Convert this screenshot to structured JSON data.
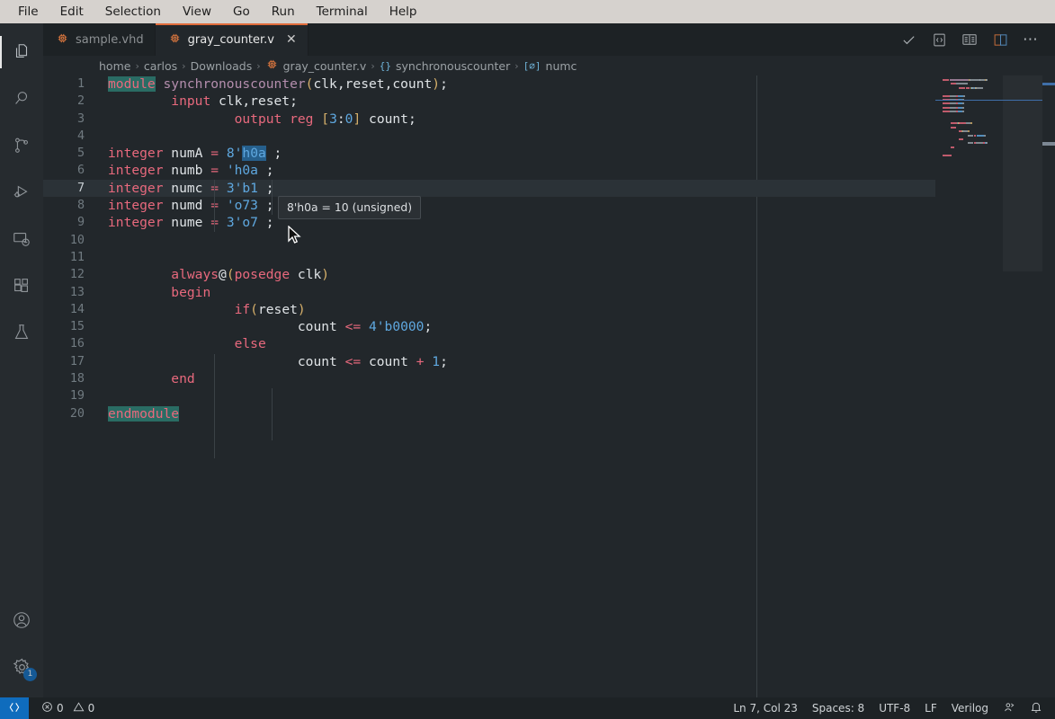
{
  "menubar": {
    "items": [
      "File",
      "Edit",
      "Selection",
      "View",
      "Go",
      "Run",
      "Terminal",
      "Help"
    ]
  },
  "activitybar": {
    "items": [
      {
        "name": "explorer",
        "icon": "files-icon",
        "active": true
      },
      {
        "name": "search",
        "icon": "search-icon",
        "active": false
      },
      {
        "name": "source-control",
        "icon": "source-control-icon",
        "active": false
      },
      {
        "name": "run-debug",
        "icon": "run-debug-icon",
        "active": false
      },
      {
        "name": "remote-explorer",
        "icon": "remote-explorer-icon",
        "active": false
      },
      {
        "name": "extensions",
        "icon": "extensions-icon",
        "active": false
      },
      {
        "name": "testing",
        "icon": "beaker-icon",
        "active": false
      }
    ],
    "bottom": [
      {
        "name": "accounts",
        "icon": "account-icon",
        "badge": ""
      },
      {
        "name": "manage",
        "icon": "gear-icon",
        "badge": "1"
      }
    ]
  },
  "tabs": [
    {
      "label": "sample.vhd",
      "icon": "chip-icon",
      "active": false,
      "closable": false
    },
    {
      "label": "gray_counter.v",
      "icon": "chip-icon",
      "active": true,
      "closable": true,
      "close_glyph": "✕"
    }
  ],
  "editor_actions": [
    {
      "name": "run-check",
      "icon": "check-icon"
    },
    {
      "name": "open-source-preview",
      "icon": "code-preview-icon"
    },
    {
      "name": "open-preview",
      "icon": "book-preview-icon"
    },
    {
      "name": "split-editor-right",
      "icon": "split-editor-icon"
    },
    {
      "name": "more-actions",
      "icon": "ellipsis-icon",
      "glyph": "⋯"
    }
  ],
  "breadcrumbs": [
    {
      "label": "home",
      "icon": ""
    },
    {
      "label": "carlos",
      "icon": ""
    },
    {
      "label": "Downloads",
      "icon": ""
    },
    {
      "label": "gray_counter.v",
      "icon": "chip-icon"
    },
    {
      "label": "synchronouscounter",
      "icon": "braces-icon",
      "icon_text": "{}"
    },
    {
      "label": "numc",
      "icon": "variable-icon",
      "icon_text": "[⌀]"
    }
  ],
  "breadcrumb_separator": "›",
  "code": {
    "language": "Verilog",
    "lines": [
      {
        "n": "1",
        "current": false,
        "tokens": [
          {
            "t": "module",
            "c": "kw match"
          },
          {
            "t": " ",
            "c": ""
          },
          {
            "t": "synchronouscounter",
            "c": "fn"
          },
          {
            "t": "(",
            "c": "punc"
          },
          {
            "t": "clk",
            "c": "var"
          },
          {
            "t": ",",
            "c": "var"
          },
          {
            "t": "reset",
            "c": "var"
          },
          {
            "t": ",",
            "c": "var"
          },
          {
            "t": "count",
            "c": "var"
          },
          {
            "t": ")",
            "c": "punc"
          },
          {
            "t": ";",
            "c": "var"
          }
        ]
      },
      {
        "n": "2",
        "current": false,
        "tokens": [
          {
            "t": "        ",
            "c": ""
          },
          {
            "t": "input",
            "c": "kw"
          },
          {
            "t": " clk,reset;",
            "c": "var"
          }
        ]
      },
      {
        "n": "3",
        "current": false,
        "tokens": [
          {
            "t": "                ",
            "c": ""
          },
          {
            "t": "output",
            "c": "kw"
          },
          {
            "t": " ",
            "c": ""
          },
          {
            "t": "reg",
            "c": "kw"
          },
          {
            "t": " ",
            "c": ""
          },
          {
            "t": "[",
            "c": "punc"
          },
          {
            "t": "3",
            "c": "num"
          },
          {
            "t": ":",
            "c": "var"
          },
          {
            "t": "0",
            "c": "num"
          },
          {
            "t": "]",
            "c": "punc"
          },
          {
            "t": " count;",
            "c": "var"
          }
        ]
      },
      {
        "n": "4",
        "current": false,
        "tokens": []
      },
      {
        "n": "5",
        "current": false,
        "tokens": [
          {
            "t": "integer",
            "c": "kw"
          },
          {
            "t": " numA ",
            "c": "var"
          },
          {
            "t": "=",
            "c": "op"
          },
          {
            "t": " ",
            "c": ""
          },
          {
            "t": "8'",
            "c": "num"
          },
          {
            "t": "h0a",
            "c": "num sel"
          },
          {
            "t": " ;",
            "c": "var"
          }
        ]
      },
      {
        "n": "6",
        "current": false,
        "tokens": [
          {
            "t": "integer",
            "c": "kw"
          },
          {
            "t": " numb ",
            "c": "var"
          },
          {
            "t": "=",
            "c": "op"
          },
          {
            "t": " ",
            "c": ""
          },
          {
            "t": "'h0a",
            "c": "num"
          },
          {
            "t": " ;",
            "c": "var"
          }
        ]
      },
      {
        "n": "7",
        "current": true,
        "tokens": [
          {
            "t": "integer",
            "c": "kw"
          },
          {
            "t": " numc ",
            "c": "var"
          },
          {
            "t": "=",
            "c": "op"
          },
          {
            "t": " ",
            "c": ""
          },
          {
            "t": "3'b1",
            "c": "num"
          },
          {
            "t": " ;",
            "c": "var"
          }
        ]
      },
      {
        "n": "8",
        "current": false,
        "tokens": [
          {
            "t": "integer",
            "c": "kw"
          },
          {
            "t": " numd ",
            "c": "var"
          },
          {
            "t": "=",
            "c": "op"
          },
          {
            "t": " ",
            "c": ""
          },
          {
            "t": "'o73",
            "c": "num"
          },
          {
            "t": " ;",
            "c": "var"
          }
        ]
      },
      {
        "n": "9",
        "current": false,
        "tokens": [
          {
            "t": "integer",
            "c": "kw"
          },
          {
            "t": " nume ",
            "c": "var"
          },
          {
            "t": "=",
            "c": "op"
          },
          {
            "t": " ",
            "c": ""
          },
          {
            "t": "3'o7",
            "c": "num"
          },
          {
            "t": " ;",
            "c": "var"
          }
        ]
      },
      {
        "n": "10",
        "current": false,
        "tokens": []
      },
      {
        "n": "11",
        "current": false,
        "tokens": []
      },
      {
        "n": "12",
        "current": false,
        "tokens": [
          {
            "t": "        ",
            "c": ""
          },
          {
            "t": "always",
            "c": "kw"
          },
          {
            "t": "@",
            "c": "var"
          },
          {
            "t": "(",
            "c": "punc"
          },
          {
            "t": "posedge",
            "c": "kw"
          },
          {
            "t": " clk",
            "c": "var"
          },
          {
            "t": ")",
            "c": "punc"
          }
        ]
      },
      {
        "n": "13",
        "current": false,
        "tokens": [
          {
            "t": "        ",
            "c": ""
          },
          {
            "t": "begin",
            "c": "kw"
          }
        ]
      },
      {
        "n": "14",
        "current": false,
        "tokens": [
          {
            "t": "                ",
            "c": ""
          },
          {
            "t": "if",
            "c": "kw"
          },
          {
            "t": "(",
            "c": "punc"
          },
          {
            "t": "reset",
            "c": "var"
          },
          {
            "t": ")",
            "c": "punc"
          }
        ]
      },
      {
        "n": "15",
        "current": false,
        "tokens": [
          {
            "t": "                        ",
            "c": ""
          },
          {
            "t": "count ",
            "c": "var"
          },
          {
            "t": "<=",
            "c": "op"
          },
          {
            "t": " ",
            "c": ""
          },
          {
            "t": "4'b0000",
            "c": "num"
          },
          {
            "t": ";",
            "c": "var"
          }
        ]
      },
      {
        "n": "16",
        "current": false,
        "tokens": [
          {
            "t": "                ",
            "c": ""
          },
          {
            "t": "else",
            "c": "kw"
          }
        ]
      },
      {
        "n": "17",
        "current": false,
        "tokens": [
          {
            "t": "                        ",
            "c": ""
          },
          {
            "t": "count ",
            "c": "var"
          },
          {
            "t": "<=",
            "c": "op"
          },
          {
            "t": " count ",
            "c": "var"
          },
          {
            "t": "+",
            "c": "op"
          },
          {
            "t": " ",
            "c": ""
          },
          {
            "t": "1",
            "c": "num"
          },
          {
            "t": ";",
            "c": "var"
          }
        ]
      },
      {
        "n": "18",
        "current": false,
        "tokens": [
          {
            "t": "        ",
            "c": ""
          },
          {
            "t": "end",
            "c": "kw"
          }
        ]
      },
      {
        "n": "19",
        "current": false,
        "tokens": []
      },
      {
        "n": "20",
        "current": false,
        "tokens": [
          {
            "t": "endmodule",
            "c": "kw match"
          }
        ]
      }
    ]
  },
  "hover_tooltip": {
    "text": "8'h0a = 10 (unsigned)"
  },
  "statusbar": {
    "remote_icon": "remote-indicator-icon",
    "problems": {
      "errors": "0",
      "warnings": "0",
      "error_icon": "error-circle-icon",
      "warning_icon": "warning-triangle-icon"
    },
    "right": [
      {
        "name": "editor-position",
        "label": "Ln 7, Col 23"
      },
      {
        "name": "editor-indentation",
        "label": "Spaces: 8"
      },
      {
        "name": "editor-encoding",
        "label": "UTF-8"
      },
      {
        "name": "editor-eol",
        "label": "LF"
      },
      {
        "name": "editor-language",
        "label": "Verilog"
      },
      {
        "name": "feedback",
        "label": "",
        "icon": "feedback-icon"
      },
      {
        "name": "notifications",
        "label": "",
        "icon": "bell-icon"
      }
    ]
  },
  "colors": {
    "accent": "#0f6cbd",
    "tab_active_border": "#e06c3b",
    "editor_bg": "#22272b",
    "keyword": "#e8697d",
    "number": "#5fa8e0",
    "function": "#b48ead",
    "match_highlight": "#2a6c64"
  }
}
